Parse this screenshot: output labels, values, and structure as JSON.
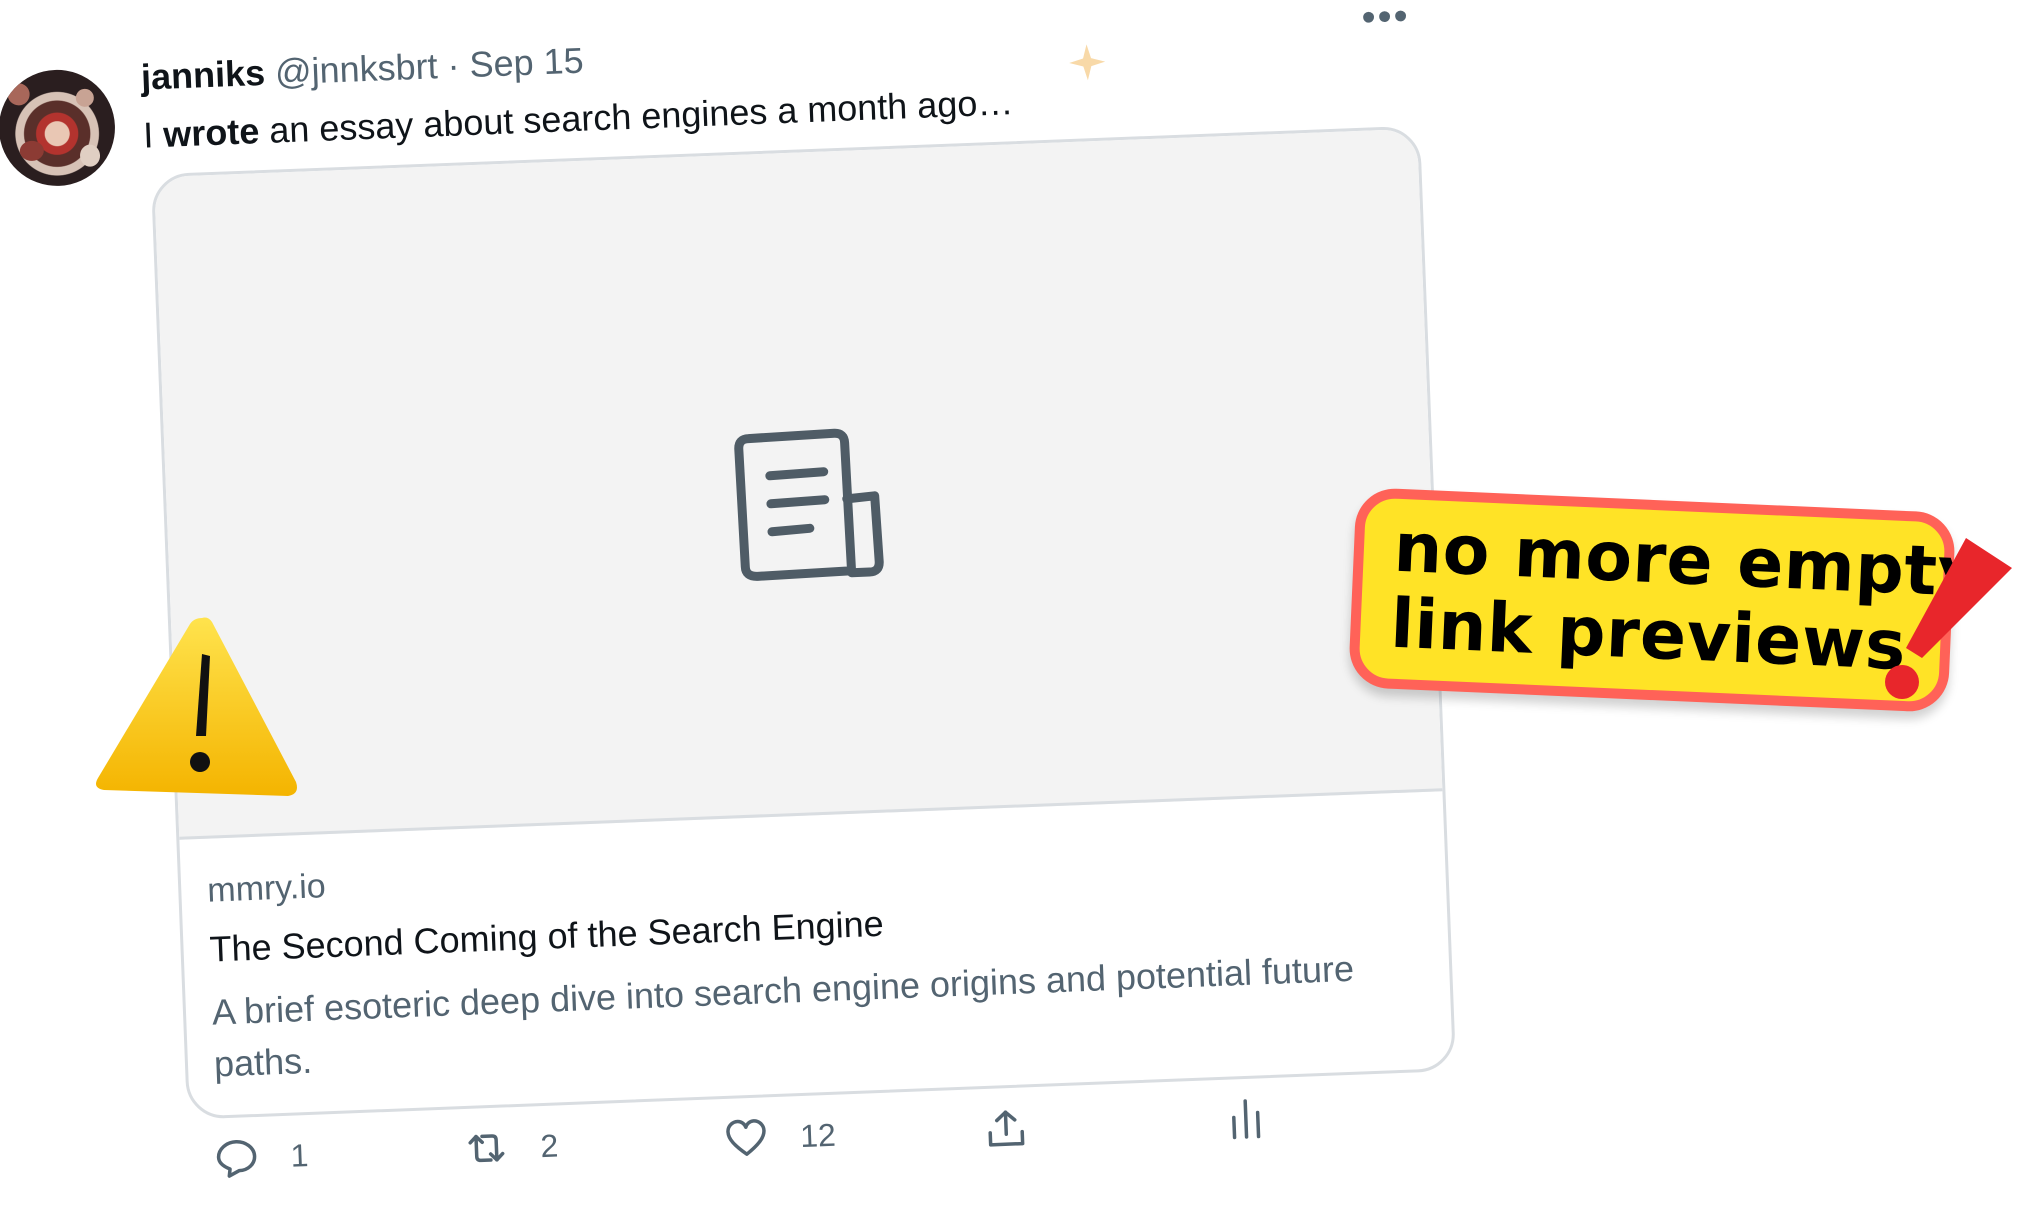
{
  "tweet": {
    "author_name": "janniks",
    "author_handle": "@jnnksbrt",
    "separator": "·",
    "date": "Sep 15",
    "more_label": "•••",
    "text_prefix": "I",
    "text_bold": "wrote",
    "text_rest": "an essay about search engines a month ago…"
  },
  "link_card": {
    "media_icon": "document-icon",
    "domain": "mmry.io",
    "title": "The Second Coming of the Search Engine",
    "description": "A brief esoteric deep dive into search engine origins and potential future paths."
  },
  "actions": {
    "reply": {
      "icon": "reply-icon",
      "count": "1"
    },
    "retweet": {
      "icon": "retweet-icon",
      "count": "2"
    },
    "like": {
      "icon": "heart-icon",
      "count": "12"
    },
    "share": {
      "icon": "share-icon"
    },
    "analytics": {
      "icon": "analytics-icon"
    }
  },
  "overlay": {
    "badge_line1": "no more empty",
    "badge_line2": "link previews",
    "badge_bg_color": "#ffe326",
    "badge_border_color": "#ff6258",
    "warning_icon": "warning-triangle-icon",
    "exclamation_icon": "red-exclamation-icon"
  }
}
